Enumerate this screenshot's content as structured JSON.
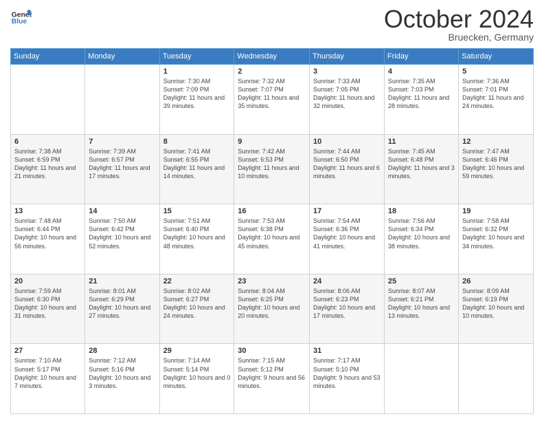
{
  "header": {
    "logo_line1": "General",
    "logo_line2": "Blue",
    "month": "October 2024",
    "location": "Bruecken, Germany"
  },
  "weekdays": [
    "Sunday",
    "Monday",
    "Tuesday",
    "Wednesday",
    "Thursday",
    "Friday",
    "Saturday"
  ],
  "weeks": [
    [
      {
        "day": "",
        "info": ""
      },
      {
        "day": "",
        "info": ""
      },
      {
        "day": "1",
        "info": "Sunrise: 7:30 AM\nSunset: 7:09 PM\nDaylight: 11 hours and 39 minutes."
      },
      {
        "day": "2",
        "info": "Sunrise: 7:32 AM\nSunset: 7:07 PM\nDaylight: 11 hours and 35 minutes."
      },
      {
        "day": "3",
        "info": "Sunrise: 7:33 AM\nSunset: 7:05 PM\nDaylight: 11 hours and 32 minutes."
      },
      {
        "day": "4",
        "info": "Sunrise: 7:35 AM\nSunset: 7:03 PM\nDaylight: 11 hours and 28 minutes."
      },
      {
        "day": "5",
        "info": "Sunrise: 7:36 AM\nSunset: 7:01 PM\nDaylight: 11 hours and 24 minutes."
      }
    ],
    [
      {
        "day": "6",
        "info": "Sunrise: 7:38 AM\nSunset: 6:59 PM\nDaylight: 11 hours and 21 minutes."
      },
      {
        "day": "7",
        "info": "Sunrise: 7:39 AM\nSunset: 6:57 PM\nDaylight: 11 hours and 17 minutes."
      },
      {
        "day": "8",
        "info": "Sunrise: 7:41 AM\nSunset: 6:55 PM\nDaylight: 11 hours and 14 minutes."
      },
      {
        "day": "9",
        "info": "Sunrise: 7:42 AM\nSunset: 6:53 PM\nDaylight: 11 hours and 10 minutes."
      },
      {
        "day": "10",
        "info": "Sunrise: 7:44 AM\nSunset: 6:50 PM\nDaylight: 11 hours and 6 minutes."
      },
      {
        "day": "11",
        "info": "Sunrise: 7:45 AM\nSunset: 6:48 PM\nDaylight: 11 hours and 3 minutes."
      },
      {
        "day": "12",
        "info": "Sunrise: 7:47 AM\nSunset: 6:46 PM\nDaylight: 10 hours and 59 minutes."
      }
    ],
    [
      {
        "day": "13",
        "info": "Sunrise: 7:48 AM\nSunset: 6:44 PM\nDaylight: 10 hours and 56 minutes."
      },
      {
        "day": "14",
        "info": "Sunrise: 7:50 AM\nSunset: 6:42 PM\nDaylight: 10 hours and 52 minutes."
      },
      {
        "day": "15",
        "info": "Sunrise: 7:51 AM\nSunset: 6:40 PM\nDaylight: 10 hours and 48 minutes."
      },
      {
        "day": "16",
        "info": "Sunrise: 7:53 AM\nSunset: 6:38 PM\nDaylight: 10 hours and 45 minutes."
      },
      {
        "day": "17",
        "info": "Sunrise: 7:54 AM\nSunset: 6:36 PM\nDaylight: 10 hours and 41 minutes."
      },
      {
        "day": "18",
        "info": "Sunrise: 7:56 AM\nSunset: 6:34 PM\nDaylight: 10 hours and 38 minutes."
      },
      {
        "day": "19",
        "info": "Sunrise: 7:58 AM\nSunset: 6:32 PM\nDaylight: 10 hours and 34 minutes."
      }
    ],
    [
      {
        "day": "20",
        "info": "Sunrise: 7:59 AM\nSunset: 6:30 PM\nDaylight: 10 hours and 31 minutes."
      },
      {
        "day": "21",
        "info": "Sunrise: 8:01 AM\nSunset: 6:29 PM\nDaylight: 10 hours and 27 minutes."
      },
      {
        "day": "22",
        "info": "Sunrise: 8:02 AM\nSunset: 6:27 PM\nDaylight: 10 hours and 24 minutes."
      },
      {
        "day": "23",
        "info": "Sunrise: 8:04 AM\nSunset: 6:25 PM\nDaylight: 10 hours and 20 minutes."
      },
      {
        "day": "24",
        "info": "Sunrise: 8:06 AM\nSunset: 6:23 PM\nDaylight: 10 hours and 17 minutes."
      },
      {
        "day": "25",
        "info": "Sunrise: 8:07 AM\nSunset: 6:21 PM\nDaylight: 10 hours and 13 minutes."
      },
      {
        "day": "26",
        "info": "Sunrise: 8:09 AM\nSunset: 6:19 PM\nDaylight: 10 hours and 10 minutes."
      }
    ],
    [
      {
        "day": "27",
        "info": "Sunrise: 7:10 AM\nSunset: 5:17 PM\nDaylight: 10 hours and 7 minutes."
      },
      {
        "day": "28",
        "info": "Sunrise: 7:12 AM\nSunset: 5:16 PM\nDaylight: 10 hours and 3 minutes."
      },
      {
        "day": "29",
        "info": "Sunrise: 7:14 AM\nSunset: 5:14 PM\nDaylight: 10 hours and 0 minutes."
      },
      {
        "day": "30",
        "info": "Sunrise: 7:15 AM\nSunset: 5:12 PM\nDaylight: 9 hours and 56 minutes."
      },
      {
        "day": "31",
        "info": "Sunrise: 7:17 AM\nSunset: 5:10 PM\nDaylight: 9 hours and 53 minutes."
      },
      {
        "day": "",
        "info": ""
      },
      {
        "day": "",
        "info": ""
      }
    ]
  ]
}
